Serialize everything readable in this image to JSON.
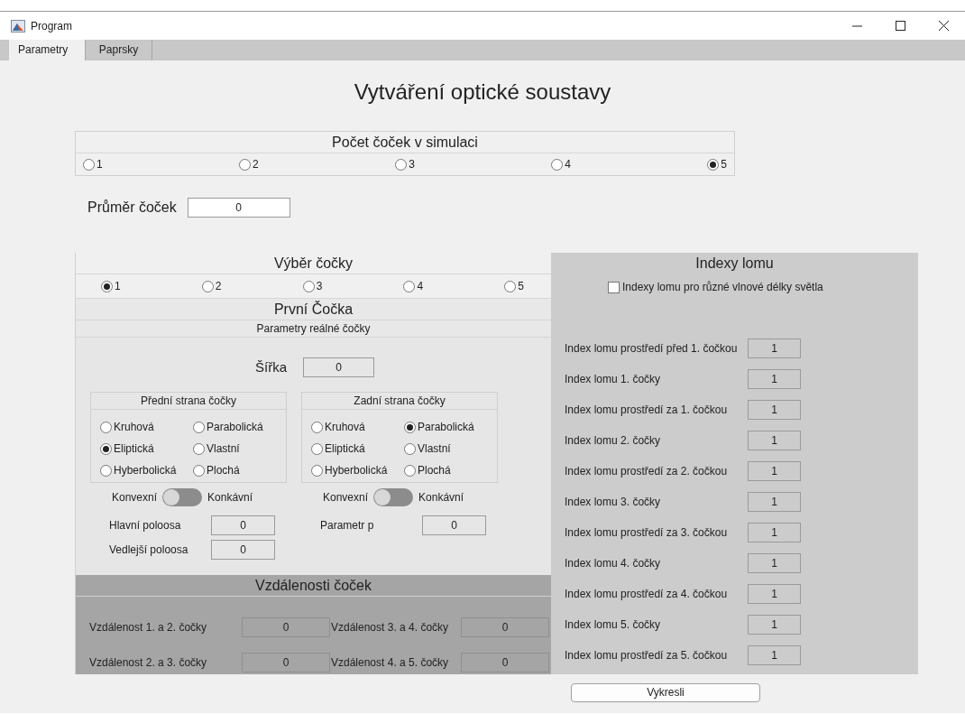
{
  "window": {
    "title": "Program"
  },
  "tabs": [
    {
      "label": "Parametry",
      "selected": true
    },
    {
      "label": "Paprsky",
      "selected": false
    }
  ],
  "heading": "Vytváření optické soustavy",
  "lens_count": {
    "title": "Počet čoček v simulaci",
    "options": [
      {
        "label": "1",
        "selected": false
      },
      {
        "label": "2",
        "selected": false
      },
      {
        "label": "3",
        "selected": false
      },
      {
        "label": "4",
        "selected": false
      },
      {
        "label": "5",
        "selected": true
      }
    ]
  },
  "diameter": {
    "label": "Průměr čoček",
    "value": "0"
  },
  "lens_selection": {
    "title": "Výběr čočky",
    "options": [
      {
        "label": "1",
        "selected": true
      },
      {
        "label": "2",
        "selected": false
      },
      {
        "label": "3",
        "selected": false
      },
      {
        "label": "4",
        "selected": false
      },
      {
        "label": "5",
        "selected": false
      }
    ]
  },
  "lens": {
    "title": "První Čočka",
    "subtitle": "Parametry reálné čočky",
    "width": {
      "label": "Šířka",
      "value": "0"
    },
    "sides": [
      {
        "title": "Přední strana čočky",
        "options": [
          {
            "label": "Kruhová",
            "selected": false
          },
          {
            "label": "Parabolická",
            "selected": false
          },
          {
            "label": "Eliptická",
            "selected": true
          },
          {
            "label": "Vlastní",
            "selected": false
          },
          {
            "label": "Hyberbolická",
            "selected": false
          },
          {
            "label": "Plochá",
            "selected": false
          }
        ],
        "toggle": {
          "left_label": "Konvexní",
          "right_label": "Konkávní",
          "on": false
        },
        "fields": [
          {
            "label": "Hlavní poloosa",
            "value": "0"
          },
          {
            "label": "Vedlejší poloosa",
            "value": "0"
          }
        ]
      },
      {
        "title": "Zadní strana čočky",
        "options": [
          {
            "label": "Kruhová",
            "selected": false
          },
          {
            "label": "Parabolická",
            "selected": true
          },
          {
            "label": "Eliptická",
            "selected": false
          },
          {
            "label": "Vlastní",
            "selected": false
          },
          {
            "label": "Hyberbolická",
            "selected": false
          },
          {
            "label": "Plochá",
            "selected": false
          }
        ],
        "toggle": {
          "left_label": "Konvexní",
          "right_label": "Konkávní",
          "on": false
        },
        "fields": [
          {
            "label": "Parametr p",
            "value": "0"
          }
        ]
      }
    ]
  },
  "distances": {
    "title": "Vzdálenosti čoček",
    "fields": [
      {
        "label": "Vzdálenost 1. a 2. čočky",
        "value": "0"
      },
      {
        "label": "Vzdálenost 3. a 4. čočky",
        "value": "0"
      },
      {
        "label": "Vzdálenost 2. a 3. čočky",
        "value": "0"
      },
      {
        "label": "Vzdálenost 4. a 5. čočky",
        "value": "0"
      }
    ]
  },
  "refraction": {
    "title": "Indexy lomu",
    "checkbox": {
      "label": "Indexy lomu pro různé vlnové délky světla",
      "checked": false
    },
    "fields": [
      {
        "label": "Index lomu prostředí před 1. čočkou",
        "value": "1"
      },
      {
        "label": "Index lomu 1. čočky",
        "value": "1"
      },
      {
        "label": "Index lomu prostředí za 1. čočkou",
        "value": "1"
      },
      {
        "label": "Index lomu 2. čočky",
        "value": "1"
      },
      {
        "label": "Index lomu prostředí za 2. čočkou",
        "value": "1"
      },
      {
        "label": "Index lomu 3. čočky",
        "value": "1"
      },
      {
        "label": "Index lomu prostředí za 3. čočkou",
        "value": "1"
      },
      {
        "label": "Index lomu 4. čočky",
        "value": "1"
      },
      {
        "label": "Index lomu prostředí za 4. čočkou",
        "value": "1"
      },
      {
        "label": "Index lomu 5. čočky",
        "value": "1"
      },
      {
        "label": "Index lomu prostředí za 5. čočkou",
        "value": "1"
      }
    ]
  },
  "button": "Vykresli"
}
